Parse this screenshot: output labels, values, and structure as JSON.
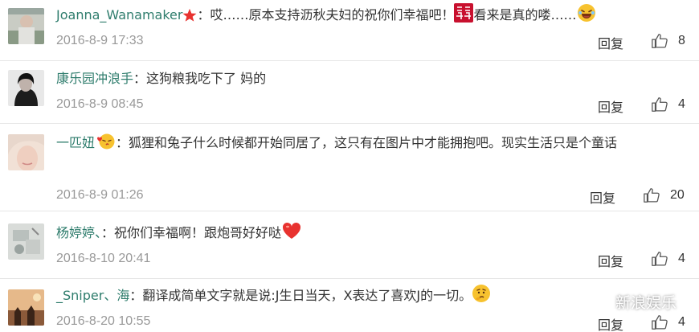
{
  "comments": [
    {
      "username": "Joanna_Wanamaker",
      "badge_icon": "red-star-icon",
      "separator": "：",
      "text_part1": "哎……原本支持沥秋夫妇的祝你们幸福吧！",
      "inline_icon": "double-happiness-icon",
      "text_part2": "看来是真的喽……",
      "trailing_icon": "laughing-emoji-icon",
      "date": "2016-8-9 17:33",
      "reply_label": "回复",
      "likes": "8"
    },
    {
      "username": "康乐园冲浪手",
      "separator": "：",
      "text": "这狗粮我吃下了 妈的",
      "date": "2016-8-9 08:45",
      "reply_label": "回复",
      "likes": "4"
    },
    {
      "username": "一匹妞",
      "badge_icon": "kiss-emoji-icon",
      "separator": "：",
      "text": "狐狸和兔子什么时候都开始同居了，这只有在图片中才能拥抱吧。现实生活只是个童话",
      "date": "2016-8-9 01:26",
      "reply_label": "回复",
      "likes": "20"
    },
    {
      "username": "杨婷婷、",
      "separator": "：",
      "text": "祝你们幸福啊！跟炮哥好好哒",
      "trailing_icon": "red-heart-icon",
      "date": "2016-8-10 20:41",
      "reply_label": "回复",
      "likes": "4"
    },
    {
      "username": "_Sniper、海",
      "separator": "：",
      "text": "翻译成简单文字就是说:J生日当天，X表达了喜欢J的一切。",
      "trailing_icon": "thinking-emoji-icon",
      "date": "2016-8-20 10:55",
      "reply_label": "回复",
      "likes": "4"
    }
  ],
  "watermark": {
    "label": "新浪娱乐",
    "icon": "weibo-logo-icon"
  },
  "colors": {
    "username": "#2f7d6d",
    "meta": "#999999",
    "divider": "#e6e6e6",
    "badge_red": "#e8322f"
  }
}
